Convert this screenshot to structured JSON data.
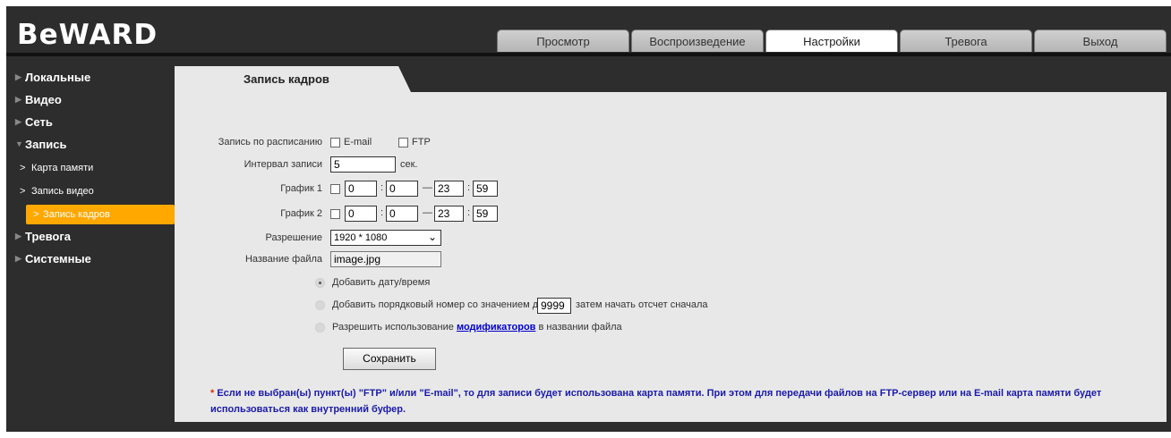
{
  "brand": {
    "logo_text": "BeWARD"
  },
  "top_tabs": [
    {
      "label": "Просмотр"
    },
    {
      "label": "Воспроизведение"
    },
    {
      "label": "Настройки",
      "active": true
    },
    {
      "label": "Тревога"
    },
    {
      "label": "Выход"
    }
  ],
  "sidebar": {
    "local": "Локальные",
    "video": "Видео",
    "network": "Сеть",
    "record": "Запись",
    "memory_card": "Карта памяти",
    "video_record": "Запись видео",
    "frame_record": "Запись кадров",
    "alarm": "Тревога",
    "system": "Системные"
  },
  "panel": {
    "tab_title": "Запись кадров",
    "schedule_label": "Запись по расписанию",
    "email_label": "E-mail",
    "ftp_label": "FTP",
    "interval_label": "Интервал записи",
    "interval_value": "5",
    "interval_unit": "сек.",
    "graph1_label": "График 1",
    "graph1": {
      "h1": "0",
      "m1": "0",
      "h2": "23",
      "m2": "59"
    },
    "graph2_label": "График 2",
    "graph2": {
      "h1": "0",
      "m1": "0",
      "h2": "23",
      "m2": "59"
    },
    "resolution_label": "Разрешение",
    "resolution_value": "1920 * 1080",
    "filename_label": "Название файла",
    "filename_value": "image.jpg",
    "radio_date": "Добавить дату/время",
    "radio_seq_before": "Добавить порядковый номер со значением до",
    "radio_seq_value": "9999",
    "radio_seq_after": "затем начать отсчет сначала",
    "radio_mod_before": "Разрешить использование",
    "radio_mod_link": "модификаторов",
    "radio_mod_after": "в названии файла",
    "save_label": "Сохранить",
    "note_star": "*",
    "note_text": "Если не выбран(ы) пункт(ы) \"FTP\" и/или \"E-mail\", то для записи будет использована карта памяти. При этом для передачи файлов на FTP-сервер или на E-mail карта памяти будет использоваться как внутренний буфер."
  },
  "colors": {
    "background": "#2d2d2d",
    "panel": "#e8e8e8",
    "accent": "#ffa800",
    "note": "#1a1aaa"
  },
  "icons": {
    "sidebar_collapsed": "triangle-right-icon",
    "sidebar_expanded": "triangle-down-icon",
    "submenu": "chevron-right-icon",
    "select": "chevron-down-icon"
  }
}
